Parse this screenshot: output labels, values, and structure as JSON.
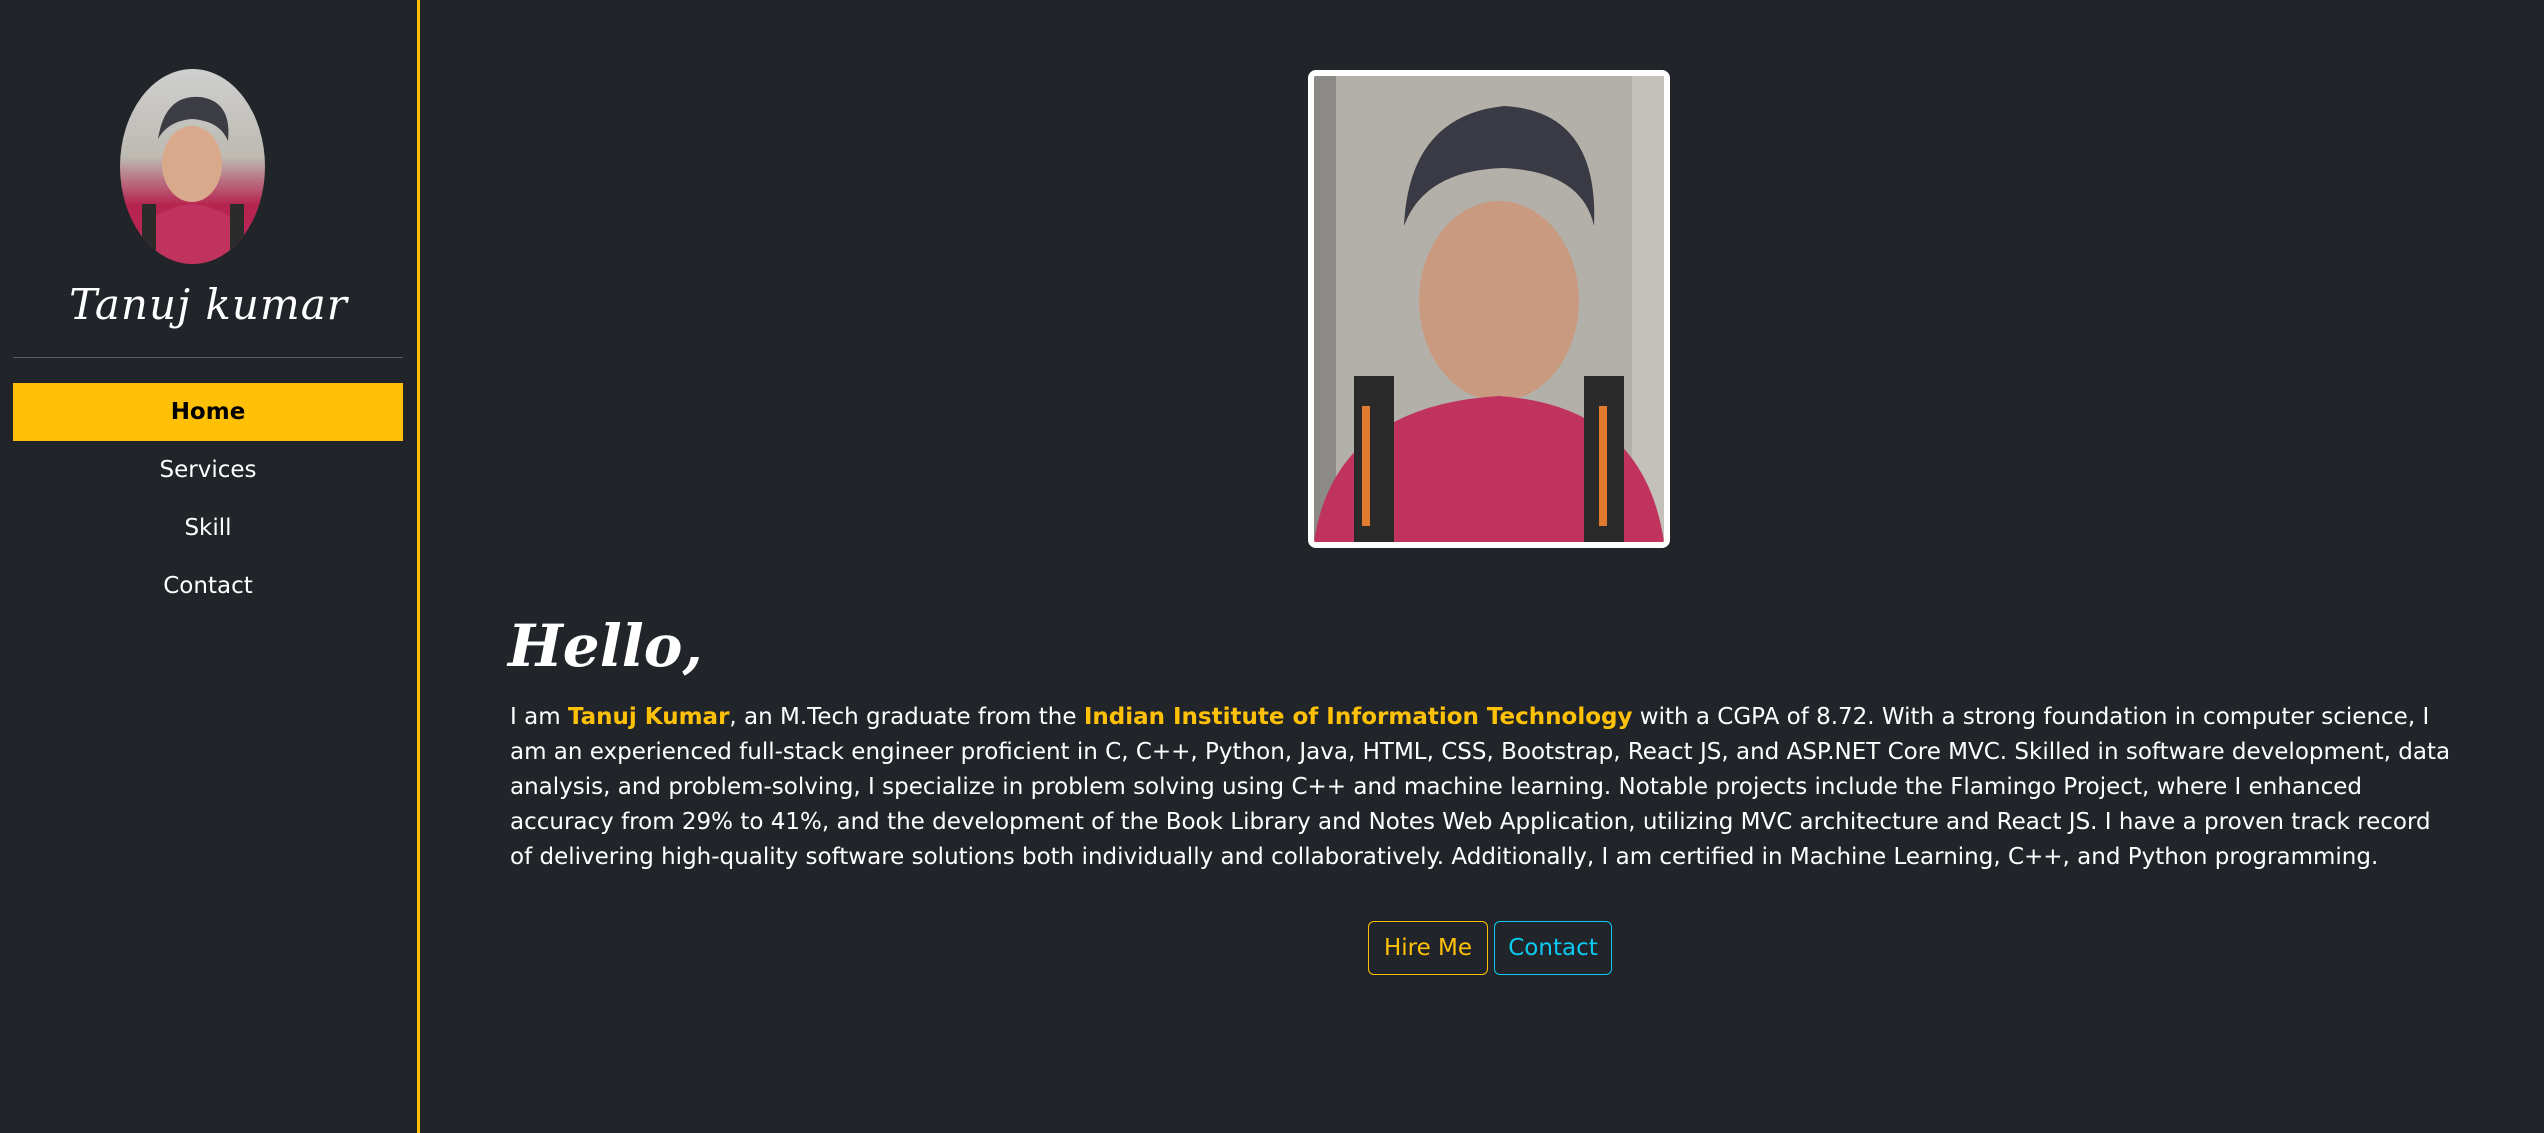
{
  "sidebar": {
    "brand_name": "Tanuj kumar",
    "nav": [
      {
        "label": "Home",
        "active": true
      },
      {
        "label": "Services",
        "active": false
      },
      {
        "label": "Skill",
        "active": false
      },
      {
        "label": "Contact",
        "active": false
      }
    ]
  },
  "main": {
    "greeting": "Hello,",
    "bio": {
      "part1": "I am ",
      "name": "Tanuj Kumar",
      "part2": ", an M.Tech graduate from the ",
      "institute": "Indian Institute of Information Technology",
      "part3": " with a CGPA of 8.72. With a strong foundation in computer science, I am an experienced full-stack engineer proficient in C, C++, Python, Java, HTML, CSS, Bootstrap, React JS, and ASP.NET Core MVC. Skilled in software development, data analysis, and problem-solving, I specialize in problem solving using C++ and machine learning. Notable projects include the Flamingo Project, where I enhanced accuracy from 29% to 41%, and the development of the Book Library and Notes Web Application, utilizing MVC architecture and React JS. I have a proven track record of delivering high-quality software solutions both individually and collaboratively. Additionally, I am certified in Machine Learning, C++, and Python programming."
    },
    "buttons": {
      "hire_label": "Hire Me",
      "contact_label": "Contact"
    }
  },
  "colors": {
    "background": "#212529",
    "accent": "#ffc107",
    "info": "#0dcaf0"
  }
}
